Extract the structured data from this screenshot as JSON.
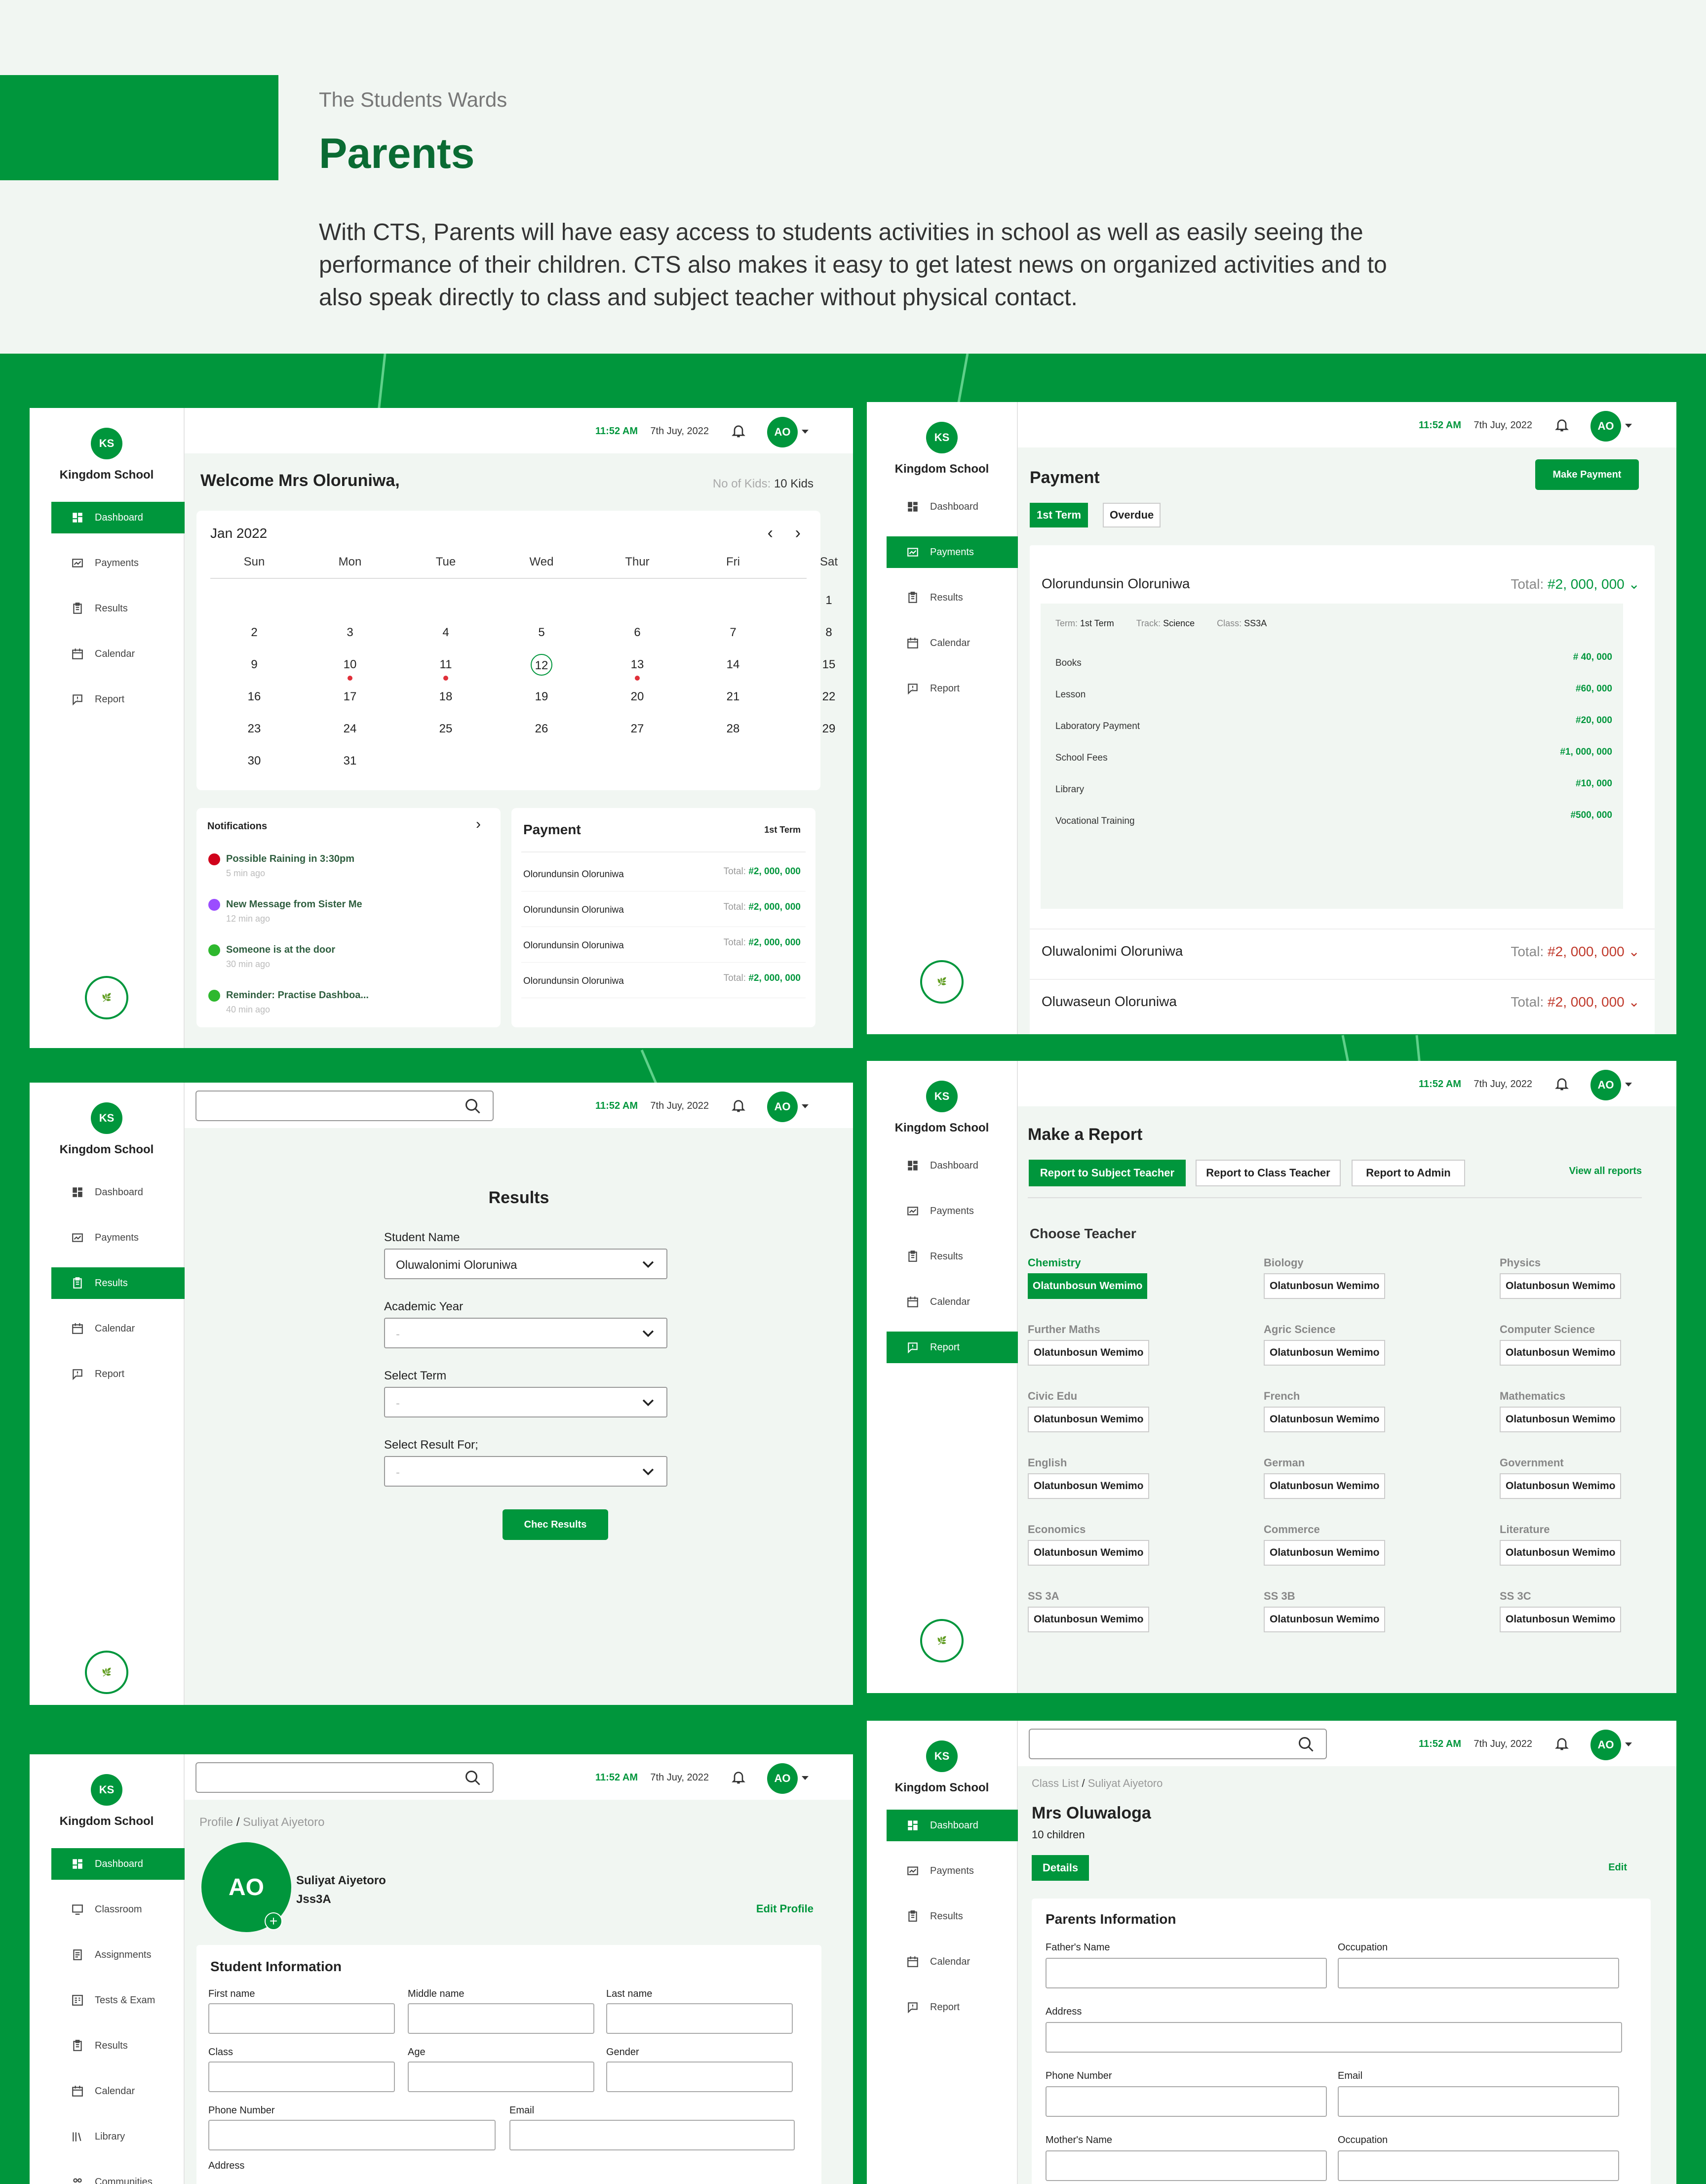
{
  "hero": {
    "eyebrow": "The Students Wards",
    "title": "Parents",
    "description": "With CTS, Parents will have easy access to students activities in school as well as easily seeing the performance of their children. CTS also makes it easy to get latest news on organized activities and to also speak directly to class and subject teacher without physical contact."
  },
  "school": {
    "name": "Kingdom School",
    "logo_initials": "KS"
  },
  "topbar": {
    "time": "11:52 AM",
    "date": "7th Juy, 2022",
    "avatar": "AO"
  },
  "nav": [
    "Dashboard",
    "Payments",
    "Results",
    "Calendar",
    "Report"
  ],
  "nav_icons": [
    "dashboard-icon",
    "payments-icon",
    "results-icon",
    "calendar-icon",
    "report-icon"
  ],
  "dashboard": {
    "welcome": "Welcome Mrs Oloruniwa,",
    "kids_label": "No of Kids:",
    "kids_value": "10 Kids",
    "calendar": {
      "month": "Jan 2022",
      "weekdays": [
        "Sun",
        "Mon",
        "Tue",
        "Wed",
        "Thur",
        "Fri",
        "Sat"
      ],
      "rows": [
        [
          "",
          "",
          "",
          "",
          "",
          "",
          "1"
        ],
        [
          "2",
          "3",
          "4",
          "5",
          "6",
          "7",
          "8"
        ],
        [
          "9",
          "10",
          "11",
          "12",
          "13",
          "14",
          "15"
        ],
        [
          "16",
          "17",
          "18",
          "19",
          "20",
          "21",
          "22"
        ],
        [
          "23",
          "24",
          "25",
          "26",
          "27",
          "28",
          "29"
        ],
        [
          "30",
          "31",
          "",
          "",
          "",
          "",
          ""
        ]
      ],
      "today": "12",
      "event_days": [
        "10",
        "11",
        "13"
      ]
    },
    "notifications": {
      "title": "Notifications",
      "items": [
        {
          "text": "Possible Raining in 3:30pm",
          "time": "5 min ago",
          "color": "#d0021b"
        },
        {
          "text": "New Message from Sister Me",
          "time": "12 min ago",
          "color": "#9b4dff"
        },
        {
          "text": "Someone is at the door",
          "time": "30 min ago",
          "color": "#2eb82e"
        },
        {
          "text": "Reminder: Practise Dashboa...",
          "time": "40 min ago",
          "color": "#2eb82e"
        }
      ]
    },
    "payment": {
      "title": "Payment",
      "term": "1st Term",
      "total_label": "Total:",
      "rows": [
        {
          "name": "Olorundunsin Oloruniwa",
          "total": "#2, 000, 000"
        },
        {
          "name": "Olorundunsin Oloruniwa",
          "total": "#2, 000, 000"
        },
        {
          "name": "Olorundunsin Oloruniwa",
          "total": "#2, 000, 000"
        },
        {
          "name": "Olorundunsin Oloruniwa",
          "total": "#2, 000, 000"
        }
      ]
    }
  },
  "payments_page": {
    "title": "Payment",
    "make_payment": "Make Payment",
    "tabs": [
      "1st Term",
      "Overdue"
    ],
    "total_label": "Total:",
    "children": [
      {
        "name": "Olorundunsin Oloruniwa",
        "total": "#2, 000, 000"
      },
      {
        "name": "Oluwalonimi Oloruniwa",
        "total": "#2, 000, 000"
      },
      {
        "name": "Oluwaseun Oloruniwa",
        "total": "#2, 000, 000"
      }
    ],
    "detail": {
      "term_label": "Term:",
      "term": "1st Term",
      "track_label": "Track:",
      "track": "Science",
      "class_label": "Class:",
      "class": "SS3A",
      "items": [
        {
          "name": "Books",
          "amount": "# 40, 000"
        },
        {
          "name": "Lesson",
          "amount": "#60, 000"
        },
        {
          "name": "Laboratory Payment",
          "amount": "#20, 000"
        },
        {
          "name": "School Fees",
          "amount": "#1, 000, 000"
        },
        {
          "name": "Library",
          "amount": "#10, 000"
        },
        {
          "name": "Vocational Training",
          "amount": "#500, 000"
        }
      ]
    }
  },
  "results_page": {
    "title": "Results",
    "fields": [
      {
        "label": "Student Name",
        "value": "Oluwalonimi Oloruniwa"
      },
      {
        "label": "Academic Year",
        "value": "-"
      },
      {
        "label": "Select Term",
        "value": "-"
      },
      {
        "label": "Select Result For;",
        "value": "-"
      }
    ],
    "button": "Chec Results"
  },
  "report_page": {
    "title": "Make a Report",
    "tabs": [
      "Report to Subject Teacher",
      "Report to Class Teacher",
      "Report to Admin"
    ],
    "view_all": "View all reports",
    "choose": "Choose Teacher",
    "subjects": [
      {
        "subject": "Chemistry",
        "teacher": "Olatunbosun Wemimo"
      },
      {
        "subject": "Biology",
        "teacher": "Olatunbosun Wemimo"
      },
      {
        "subject": "Physics",
        "teacher": "Olatunbosun Wemimo"
      },
      {
        "subject": "Further Maths",
        "teacher": "Olatunbosun Wemimo"
      },
      {
        "subject": "Agric Science",
        "teacher": "Olatunbosun Wemimo"
      },
      {
        "subject": "Computer Science",
        "teacher": "Olatunbosun Wemimo"
      },
      {
        "subject": "Civic Edu",
        "teacher": "Olatunbosun Wemimo"
      },
      {
        "subject": "French",
        "teacher": "Olatunbosun Wemimo"
      },
      {
        "subject": "Mathematics",
        "teacher": "Olatunbosun Wemimo"
      },
      {
        "subject": "English",
        "teacher": "Olatunbosun Wemimo"
      },
      {
        "subject": "German",
        "teacher": "Olatunbosun Wemimo"
      },
      {
        "subject": "Government",
        "teacher": "Olatunbosun Wemimo"
      },
      {
        "subject": "Economics",
        "teacher": "Olatunbosun Wemimo"
      },
      {
        "subject": "Commerce",
        "teacher": "Olatunbosun Wemimo"
      },
      {
        "subject": "Literature",
        "teacher": "Olatunbosun Wemimo"
      },
      {
        "subject": "SS 3A",
        "teacher": "Olatunbosun Wemimo"
      },
      {
        "subject": "SS 3B",
        "teacher": "Olatunbosun Wemimo"
      },
      {
        "subject": "SS 3C",
        "teacher": "Olatunbosun Wemimo"
      }
    ]
  },
  "profile_page": {
    "nav": [
      "Dashboard",
      "Classroom",
      "Assignments",
      "Tests & Exam",
      "Results",
      "Calendar",
      "Library",
      "Communities"
    ],
    "nav_icons": [
      "dashboard-icon",
      "classroom-icon",
      "assignments-icon",
      "tests-icon",
      "results-icon",
      "calendar-icon",
      "library-icon",
      "communities-icon"
    ],
    "breadcrumb_root": "Profile",
    "breadcrumb_current": "Suliyat Aiyetoro",
    "avatar": "AO",
    "name": "Suliyat Aiyetoro",
    "class": "Jss3A",
    "edit": "Edit Profile",
    "section": "Student Information",
    "fields": [
      "First name",
      "Middle name",
      "Last name",
      "Class",
      "Age",
      "Gender"
    ],
    "phone": "Phone Number",
    "email": "Email",
    "address": "Address"
  },
  "classlist_page": {
    "breadcrumb_root": "Class List",
    "breadcrumb_current": "Suliyat Aiyetoro",
    "title": "Mrs Oluwaloga",
    "subtitle": "10 children",
    "tab": "Details",
    "edit": "Edit",
    "section": "Parents Information",
    "fields": [
      "Father's Name",
      "Occupation",
      "Address",
      "Phone Number",
      "Email",
      "Mother's Name",
      "Occupation"
    ]
  }
}
